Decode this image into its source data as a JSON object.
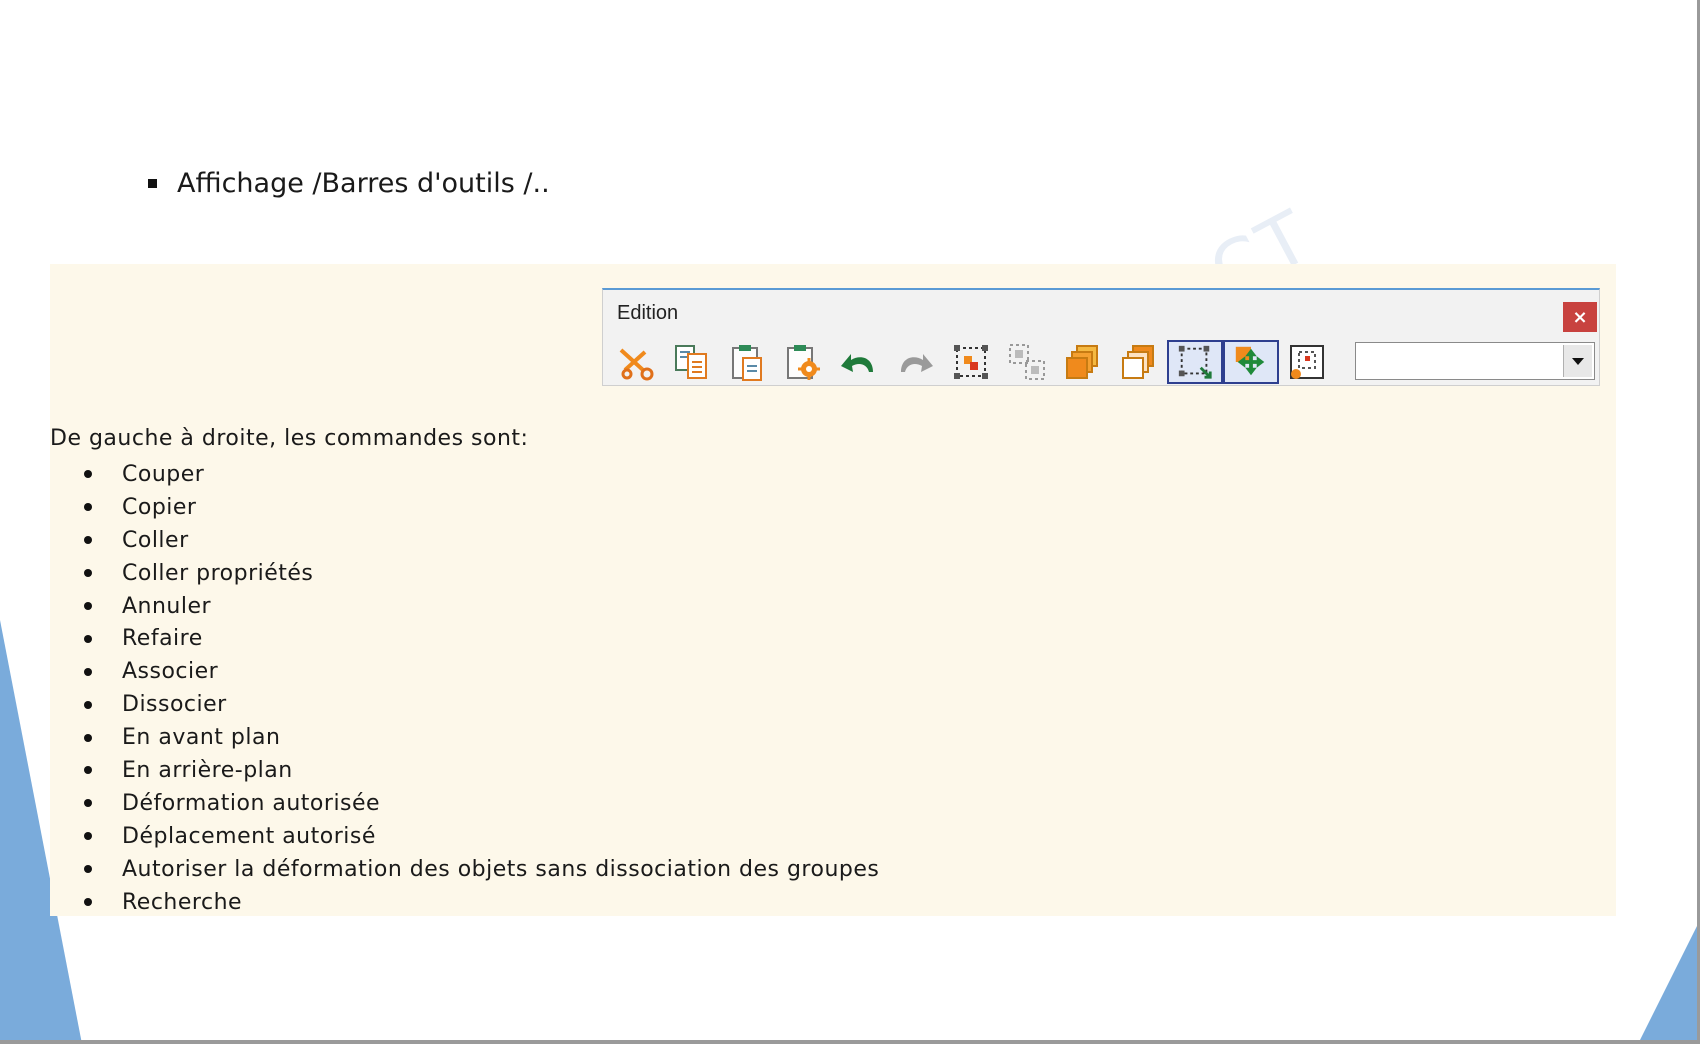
{
  "slide": {
    "bullet_text": "Affichage /Barres d'outils /..",
    "watermark": "CT"
  },
  "toolbar": {
    "title": "Edition",
    "close_label": "×",
    "icons": [
      "cut-icon",
      "copy-icon",
      "paste-icon",
      "paste-properties-icon",
      "undo-icon",
      "redo-icon",
      "group-icon",
      "ungroup-icon",
      "bring-to-front-icon",
      "send-to-back-icon",
      "allow-deformation-icon",
      "allow-move-icon",
      "deform-without-ungroup-icon"
    ],
    "combo_value": ""
  },
  "content": {
    "intro": "De gauche à droite, les commandes sont:",
    "items": [
      "Couper",
      "Copier",
      "Coller",
      "Coller propriétés",
      "Annuler",
      "Refaire",
      "Associer",
      "Dissocier",
      "En avant plan",
      "En arrière-plan",
      "Déformation autorisée",
      "Déplacement autorisé",
      "Autoriser la déformation des objets sans dissociation des groupes",
      "Recherche"
    ]
  },
  "colors": {
    "accent_blue": "#7aabdb",
    "panel_bg": "#fdf8ea",
    "close_red": "#c8423f"
  }
}
